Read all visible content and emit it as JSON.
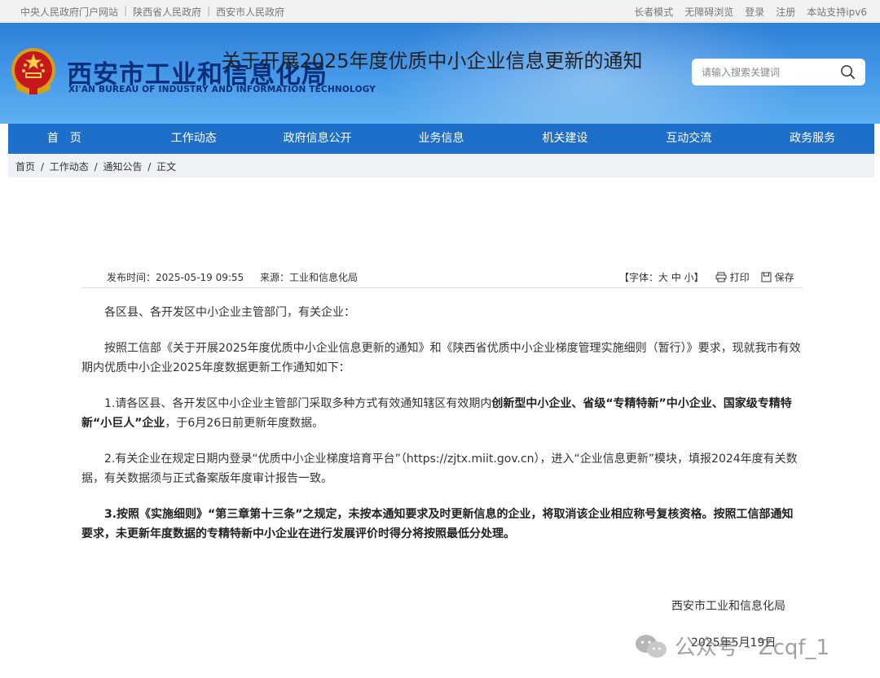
{
  "topbar": {
    "links": [
      "中央人民政府门户网站",
      "陕西省人民政府",
      "西安市人民政府"
    ],
    "right_links": [
      "长者模式",
      "无障碍浏览",
      "登录",
      "注册",
      "本站支持ipv6"
    ]
  },
  "header": {
    "title": "西安市工业和信息化局",
    "subtitle": "XI'AN BUREAU OF INDUSTRY AND INFORMATION TECHNOLOGY",
    "search_placeholder": "请输入搜索关键词",
    "colors": {
      "header_blue": "#3f93e6",
      "title_navy": "#0c2f7a",
      "nav_blue": "#1e6fc9"
    }
  },
  "nav": {
    "items": [
      "首页",
      "工作动态",
      "政府信息公开",
      "业务信息",
      "机关建设",
      "互动交流",
      "政务服务"
    ]
  },
  "breadcrumb": {
    "items": [
      "首页",
      "工作动态",
      "通知公告",
      "正文"
    ],
    "separator": "/"
  },
  "article": {
    "title": "关于开展2025年度优质中小企业信息更新的通知",
    "published_label": "发布时间：",
    "published": "2025-05-19 09:55",
    "source_label": "来源：",
    "source": "工业和信息化局",
    "font_label": "【字体：大 中 小】",
    "print_label": "打印",
    "save_label": "保存",
    "greeting": "各区县、各开发区中小企业主管部门，有关企业：",
    "intro": "按照工信部《关于开展2025年度优质中小企业信息更新的通知》和《陕西省优质中小企业梯度管理实施细则（暂行）》要求，现就我市有效期内优质中小企业2025年度数据更新工作通知如下：",
    "item1_a": "1.请各区县、各开发区中小企业主管部门采取多种方式有效通知辖区有效期内",
    "item1_b": "创新型中小企业、省级“专精特新”中小企业、国家级专精特新“小巨人”企业",
    "item1_c": "，于6月26日前更新年度数据。",
    "item2": "2.有关企业在规定日期内登录“优质中小企业梯度培育平台”（https://zjtx.miit.gov.cn），进入“企业信息更新”模块，填报2024年度有关数据，有关数据须与正式备案版年度审计报告一致。",
    "item3": "3.按照《实施细则》“第三章第十三条”之规定，未按本通知要求及时更新信息的企业，将取消该企业相应称号复核资格。按照工信部通知要求，未更新年度数据的专精特新中小企业在进行发展评价时得分将按照最低分处理。",
    "signature": "西安市工业和信息化局",
    "date": "2025年5月19日"
  },
  "watermark": {
    "text": "公众号 · Zcqf_1"
  }
}
